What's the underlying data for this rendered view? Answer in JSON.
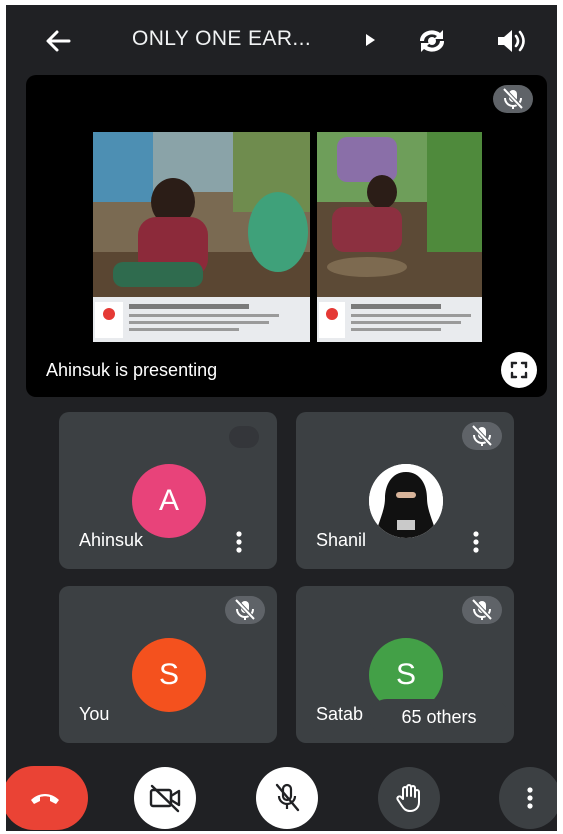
{
  "header": {
    "meeting_title": "ONLY ONE EAR...",
    "back_icon": "arrow-left-icon",
    "switch_camera_icon": "switch-camera-icon",
    "speaker_icon": "speaker-icon"
  },
  "presentation": {
    "presenter_label": "Ahinsuk is presenting",
    "fullscreen_icon": "fullscreen-icon",
    "mute_icon": "mic-off-icon"
  },
  "participants": [
    {
      "name": "Ahinsuk",
      "initial": "A",
      "avatar_color": "#e8437a",
      "muted": false
    },
    {
      "name": "Shanil",
      "initial": "",
      "avatar_color": "#ffffff",
      "muted": true
    },
    {
      "name": "You",
      "initial": "S",
      "avatar_color": "#f4511e",
      "muted": true
    },
    {
      "name": "Satab",
      "initial": "S",
      "avatar_color": "#43a047",
      "muted": true
    }
  ],
  "others": {
    "label": "65 others"
  },
  "controls": {
    "end_call_icon": "end-call-icon",
    "camera_icon": "camera-off-icon",
    "mic_icon": "mic-off-icon",
    "raise_hand_icon": "hand-icon",
    "more_icon": "more-vertical-icon"
  },
  "colors": {
    "background": "#202124",
    "tile": "#3c4043",
    "end_call": "#ea4335",
    "mute_badge": "#5f6368"
  }
}
